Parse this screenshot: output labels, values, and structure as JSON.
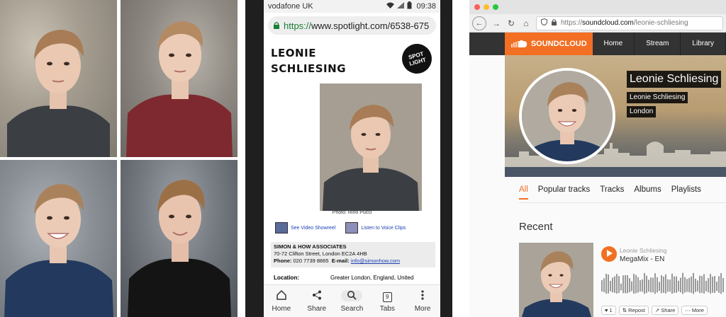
{
  "phone": {
    "status": {
      "carrier": "vodafone UK",
      "time": "09:38"
    },
    "url": {
      "scheme": "https://",
      "rest": "www.spotlight.com/6538-675"
    },
    "actor_name_line1": "LEONIE",
    "actor_name_line2": "SCHLIESING",
    "logo_text": "SPOT LIGHT",
    "photo_credit": "Photo: Rino Pucci",
    "links": {
      "video": "See Video Showreel",
      "voice": "Listen to Voice Clips"
    },
    "agency": {
      "name": "SIMON & HOW ASSOCIATES",
      "address": "70-72 Clifton Street, London EC2A 4HB",
      "phone_label": "Phone:",
      "phone": "020 7739 8865",
      "email_label": "E-mail:",
      "email": "info@simonhow.com"
    },
    "location": {
      "label": "Location:",
      "value": "Greater London, England, United"
    },
    "nav": [
      {
        "label": "Home",
        "icon": "home-icon"
      },
      {
        "label": "Share",
        "icon": "share-icon"
      },
      {
        "label": "Search",
        "icon": "search-icon"
      },
      {
        "label": "Tabs",
        "icon": "tabs-icon",
        "count": "9"
      },
      {
        "label": "More",
        "icon": "more-icon"
      }
    ]
  },
  "browser": {
    "url": {
      "prefix": "https://",
      "host": "soundcloud.com",
      "path": "/leonie-schliesing"
    },
    "nav": {
      "brand": "SOUNDCLOUD",
      "tabs": [
        "Home",
        "Stream",
        "Library"
      ]
    },
    "profile": {
      "name": "Leonie Schliesing",
      "username": "Leonie Schliesing",
      "city": "London"
    },
    "tabs": [
      "All",
      "Popular tracks",
      "Tracks",
      "Albums",
      "Playlists"
    ],
    "recent_heading": "Recent",
    "track": {
      "user": "Leonie Schliesing",
      "title": "MegaMix - EN"
    },
    "actions": {
      "like": "1",
      "repost": "Repost",
      "share": "Share",
      "more": "More"
    },
    "colors": {
      "accent": "#f26f23",
      "nav_bg": "#333333"
    }
  }
}
